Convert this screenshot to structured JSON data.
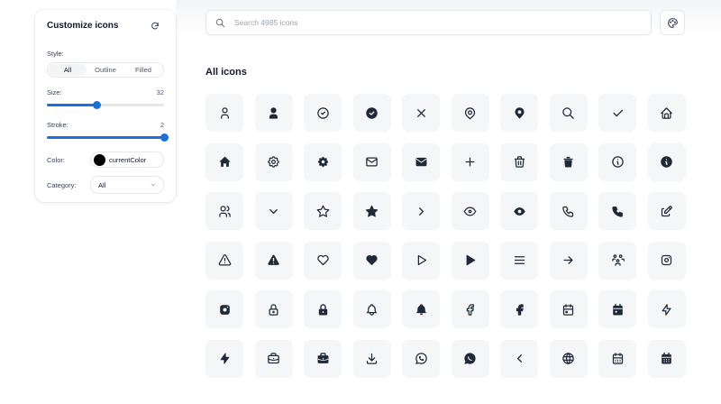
{
  "sidebar": {
    "title": "Customize icons",
    "style_label": "Style:",
    "style_options": [
      "All",
      "Outline",
      "Filled"
    ],
    "style_selected": "All",
    "size_label": "Size:",
    "size_value": "32",
    "size_fraction": 0.43,
    "stroke_label": "Stroke:",
    "stroke_value": "2",
    "stroke_fraction": 1.0,
    "color_label": "Color:",
    "color_value": "currentColor",
    "color_swatch": "#000000",
    "category_label": "Category:",
    "category_value": "All"
  },
  "search": {
    "placeholder": "Search 4985 icons",
    "value": ""
  },
  "section_title": "All icons",
  "colors": {
    "accent": "#1d6fd9",
    "tile_bg": "#f5f6f8",
    "icon": "#1f2937"
  },
  "icons": [
    "user",
    "user-filled",
    "circle-check",
    "circle-check-filled",
    "x",
    "map-pin",
    "map-pin-filled",
    "search",
    "check",
    "home",
    "home-filled",
    "settings",
    "settings-filled",
    "mail",
    "mail-filled",
    "plus",
    "trash",
    "trash-filled",
    "info-circle",
    "info-circle-filled",
    "users",
    "chevron-down",
    "star",
    "star-filled",
    "chevron-right",
    "eye",
    "eye-filled",
    "phone",
    "phone-filled",
    "edit",
    "alert-triangle",
    "alert-triangle-filled",
    "heart",
    "heart-filled",
    "player-play",
    "player-play-filled",
    "menu",
    "arrow-right",
    "users-group",
    "brand-instagram",
    "brand-instagram-filled",
    "lock",
    "lock-filled",
    "bell",
    "bell-filled",
    "brand-facebook",
    "brand-facebook-filled",
    "calendar-event",
    "calendar-event-filled",
    "bolt",
    "bolt-filled",
    "briefcase",
    "briefcase-filled",
    "download",
    "brand-whatsapp",
    "brand-whatsapp-filled",
    "chevron-left",
    "world",
    "calendar",
    "calendar-filled"
  ]
}
